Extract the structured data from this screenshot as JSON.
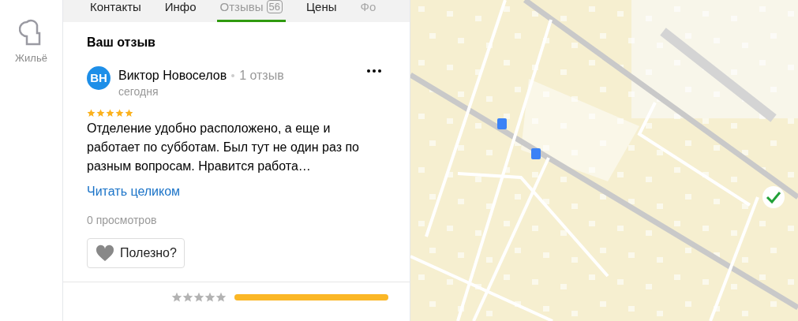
{
  "sidebar": {
    "items": [
      {
        "label": "Жильё"
      }
    ]
  },
  "tabs": [
    {
      "label": "Контакты",
      "selected": false
    },
    {
      "label": "Инфо",
      "selected": false
    },
    {
      "label": "Отзывы",
      "badge": "56",
      "selected": true
    },
    {
      "label": "Цены",
      "selected": false
    },
    {
      "label": "Фо",
      "selected": false,
      "faded": true
    }
  ],
  "review": {
    "heading": "Ваш отзыв",
    "avatar": "ВН",
    "author": "Виктор Новоселов",
    "author_reviews": "1 отзыв",
    "date": "сегодня",
    "stars": 5,
    "text": "Отделение удобно расположено, а еще и работает по субботам. Был тут не один раз по разным вопросам. Нравится работа…",
    "read_more": "Читать целиком",
    "views": "0 просмотров",
    "helpful": "Полезно?"
  },
  "rating_distribution": [
    {
      "stars": 0,
      "level": 1
    }
  ]
}
